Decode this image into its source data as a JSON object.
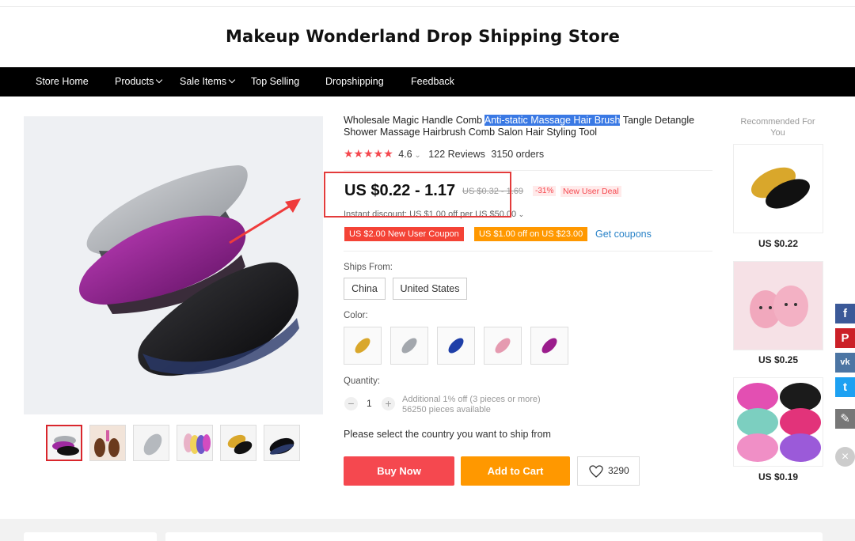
{
  "store": {
    "title": "Makeup Wonderland Drop Shipping Store"
  },
  "nav": {
    "items": [
      "Store Home",
      "Products",
      "Sale Items",
      "Top Selling",
      "Dropshipping",
      "Feedback"
    ]
  },
  "product": {
    "title_before": "Wholesale Magic Handle Comb ",
    "title_highlight": "Anti-static Massage Hair Brush",
    "title_after": " Tangle Detangle Shower Massage Hairbrush Comb Salon Hair Styling Tool",
    "rating": "4.6",
    "reviews": "122 Reviews",
    "orders": "3150 orders",
    "price": "US $0.22 - 1.17",
    "old_price": "US $0.32 - 1.69",
    "discount": "-31%",
    "new_user_deal": "New User Deal",
    "instant_discount": "Instant discount: US $1.00 off per US $50.00",
    "coupon1": "US $2.00 New User Coupon",
    "coupon2": "US $1.00 off on US $23.00",
    "get_coupons": "Get coupons",
    "ships_from_label": "Ships From:",
    "ships_from_options": [
      "China",
      "United States"
    ],
    "color_label": "Color:",
    "quantity_label": "Quantity:",
    "quantity_value": "1",
    "quantity_minus": "−",
    "quantity_plus": "+",
    "quantity_info1": "Additional 1% off (3 pieces or more)",
    "quantity_info2": "56250 pieces available",
    "ship_note": "Please select the country you want to ship from",
    "buy_now": "Buy Now",
    "add_to_cart": "Add to Cart",
    "wishlist_count": "3290"
  },
  "recommended": {
    "title": "Recommended For You",
    "items": [
      {
        "price": "US $0.22"
      },
      {
        "price": "US $0.25"
      },
      {
        "price": "US $0.19"
      }
    ]
  },
  "share": {
    "icons": [
      "facebook-icon",
      "pinterest-icon",
      "vk-icon",
      "twitter-icon",
      "edit-icon",
      "close-icon"
    ],
    "glyphs": [
      "f",
      "P",
      "vk",
      "t",
      "✎",
      "×"
    ]
  },
  "colors": {
    "nav_bg": "#000000",
    "accent_red": "#f5484f",
    "accent_orange": "#ff9800",
    "link_blue": "#2a83c8",
    "highlight": "#3a79e4"
  }
}
